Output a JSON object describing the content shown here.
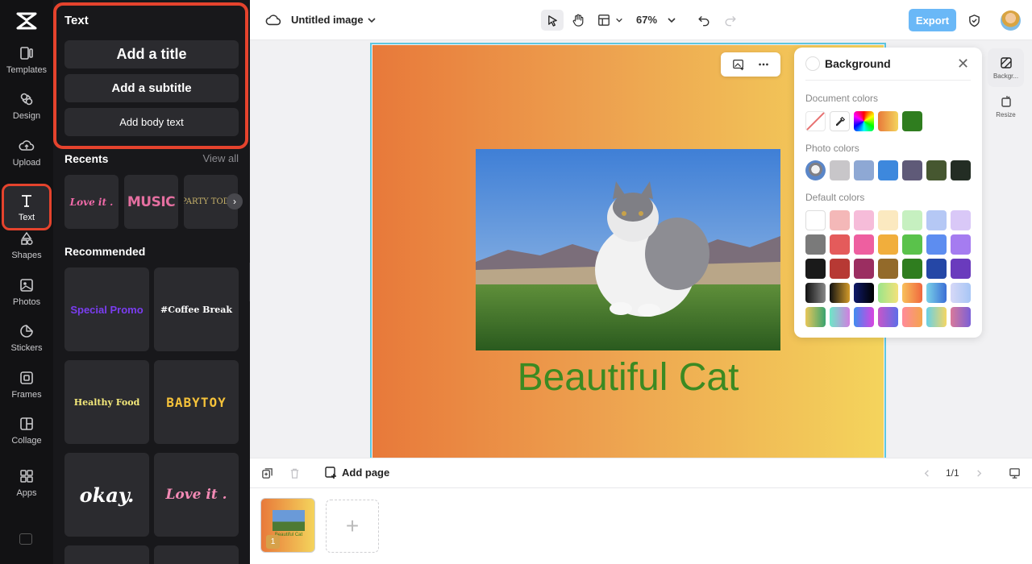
{
  "rail": {
    "items": [
      {
        "label": "Templates"
      },
      {
        "label": "Design"
      },
      {
        "label": "Upload"
      },
      {
        "label": "Text"
      },
      {
        "label": "Shapes"
      },
      {
        "label": "Photos"
      },
      {
        "label": "Stickers"
      },
      {
        "label": "Frames"
      },
      {
        "label": "Collage"
      },
      {
        "label": "Apps"
      }
    ],
    "active": "Text",
    "highlight_color": "#e5432d"
  },
  "panel": {
    "title": "Text",
    "add_title": "Add a title",
    "add_subtitle": "Add a subtitle",
    "add_body": "Add body text",
    "recents_heading": "Recents",
    "view_all": "View all",
    "recents": [
      "Love it .",
      "MUSIC",
      "PARTY TODAY"
    ],
    "recommended_heading": "Recommended",
    "templates": [
      "Special Promo",
      "#Coffee Break",
      "Healthy Food",
      "BABYTOY",
      "okay.",
      "Love it ."
    ]
  },
  "topbar": {
    "doc_title": "Untitled image",
    "zoom": "67%",
    "export_label": "Export",
    "export_color": "#6ab8f7"
  },
  "canvas": {
    "text": "Beautiful Cat",
    "text_color": "#3c8a22",
    "gradient": [
      "#e8793a",
      "#f4d45c"
    ]
  },
  "background_popup": {
    "title": "Background",
    "document_colors_label": "Document colors",
    "photo_colors_label": "Photo colors",
    "default_colors_label": "Default colors",
    "document_colors": [
      "none",
      "eyedropper",
      "rainbow",
      "#eb8c46",
      "#2f7d1f"
    ],
    "photo_colors": [
      "photo",
      "#c8c6c9",
      "#8ea8d4",
      "#3d88dd",
      "#5f5a78",
      "#465730",
      "#232d24"
    ],
    "default_colors": [
      [
        "#ffffff",
        "#f4b8b8",
        "#f6bcd9",
        "#fbe9c0",
        "#c6f0c0",
        "#b5c8f5",
        "#d9c8f7"
      ],
      [
        "#7a7a7a",
        "#e45b5b",
        "#ee5fa0",
        "#f1ae3c",
        "#5ac24b",
        "#5d8df0",
        "#a57cf0"
      ],
      [
        "#1a1a1a",
        "#b73934",
        "#9b2e61",
        "#936a2a",
        "#2f7d1f",
        "#2547a6",
        "#6a3bbd"
      ],
      [
        "linear-gradient(90deg,#111,#888)",
        "linear-gradient(90deg,#111,#d39b2a)",
        "linear-gradient(90deg,#0f1a6a,#000)",
        "linear-gradient(90deg,#9be58a,#f3e27a)",
        "linear-gradient(90deg,#f8c05a,#f0683e)",
        "linear-gradient(90deg,#7bd1e8,#3c6fd6)",
        "linear-gradient(90deg,#d6d8f7,#a8c6f5)"
      ],
      [
        "linear-gradient(90deg,#e8c75a,#39a36f)",
        "linear-gradient(90deg,#6ee7c8,#d17fe0)",
        "linear-gradient(90deg,#3f8cf0,#d844e0)",
        "linear-gradient(90deg,#c756c9,#5d6ee8)",
        "linear-gradient(90deg,#ff8a9a,#f4a44c)",
        "linear-gradient(90deg,#67d0e6,#f5d663)",
        "linear-gradient(90deg,#d97a9a,#7b5fd6)"
      ]
    ]
  },
  "side_tabs": {
    "background": "Backgr...",
    "resize": "Resize"
  },
  "pagebar": {
    "add_page": "Add page",
    "page_count": "1/1"
  },
  "thumbnails": {
    "page_number": "1"
  }
}
